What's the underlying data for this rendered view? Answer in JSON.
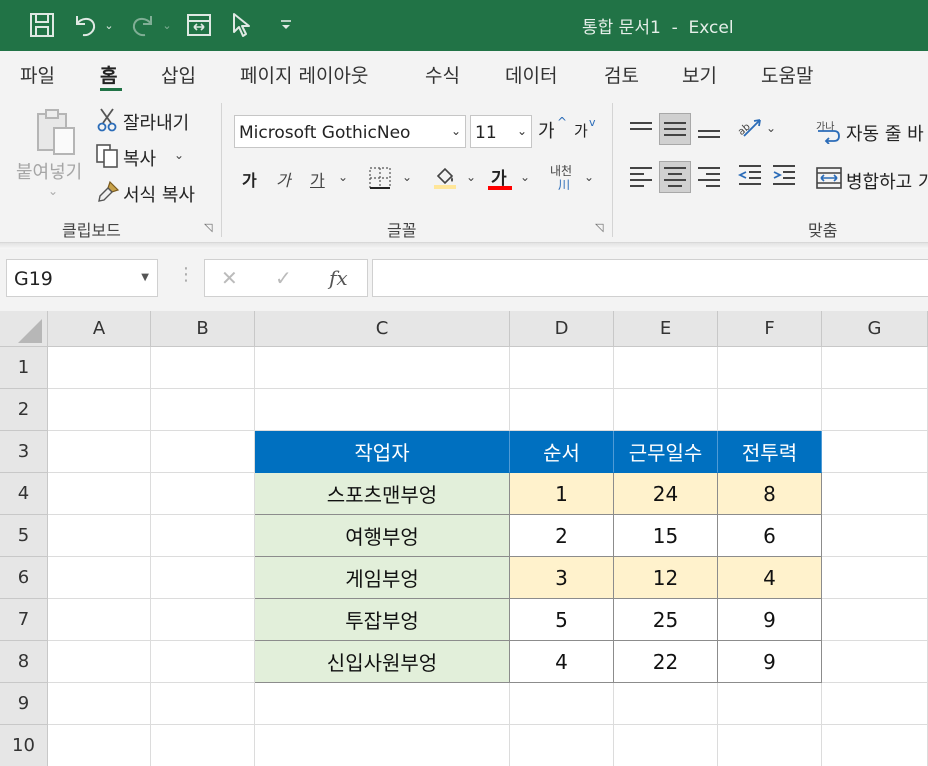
{
  "window": {
    "title": "통합 문서1  -  Excel"
  },
  "qat": {
    "icons": [
      "save-icon",
      "undo-icon",
      "redo-icon",
      "form-icon",
      "touch-mode-icon",
      "customize-qat-icon"
    ]
  },
  "tabs": [
    {
      "label": "파일"
    },
    {
      "label": "홈"
    },
    {
      "label": "삽입"
    },
    {
      "label": "페이지 레이아웃"
    },
    {
      "label": "수식"
    },
    {
      "label": "데이터"
    },
    {
      "label": "검토"
    },
    {
      "label": "보기"
    },
    {
      "label": "도움말"
    }
  ],
  "ribbon": {
    "clipboard": {
      "paste": "붙여넣기",
      "cut": "잘라내기",
      "copy": "복사",
      "format_painter": "서식 복사",
      "group_label": "클립보드"
    },
    "font": {
      "font_name": "Microsoft GothicNeo",
      "font_size": "11",
      "grow": "가",
      "shrink": "가",
      "bold": "가",
      "italic": "가",
      "underline": "가",
      "font_color": "가",
      "phonetic_top": "내천",
      "phonetic_bottom": "川",
      "group_label": "글꼴"
    },
    "alignment": {
      "orientation_label": "가",
      "wrap_text": "자동 줄 바",
      "wrap_icon_text": "가나",
      "merge": "병합하고 가",
      "group_label": "맞춤"
    }
  },
  "formula_bar": {
    "name_box": "G19",
    "cancel": "✕",
    "enter": "✓",
    "fx": "fx",
    "formula": ""
  },
  "sheet": {
    "columns": [
      "A",
      "B",
      "C",
      "D",
      "E",
      "F",
      "G"
    ],
    "rows": [
      "1",
      "2",
      "3",
      "4",
      "5",
      "6",
      "7",
      "8",
      "9",
      "10"
    ],
    "table": {
      "headers": [
        "작업자",
        "순서",
        "근무일수",
        "전투력"
      ],
      "rows": [
        [
          "스포츠맨부엉",
          "1",
          "24",
          "8"
        ],
        [
          "여행부엉",
          "2",
          "15",
          "6"
        ],
        [
          "게임부엉",
          "3",
          "12",
          "4"
        ],
        [
          "투잡부엉",
          "5",
          "25",
          "9"
        ],
        [
          "신입사원부엉",
          "4",
          "22",
          "9"
        ]
      ],
      "highlighted_rows": [
        0,
        2
      ]
    }
  },
  "colors": {
    "titlebar": "#217346",
    "header_fill": "#0070c0",
    "name_fill": "#e2efda",
    "highlight_fill": "#fff2cc"
  }
}
